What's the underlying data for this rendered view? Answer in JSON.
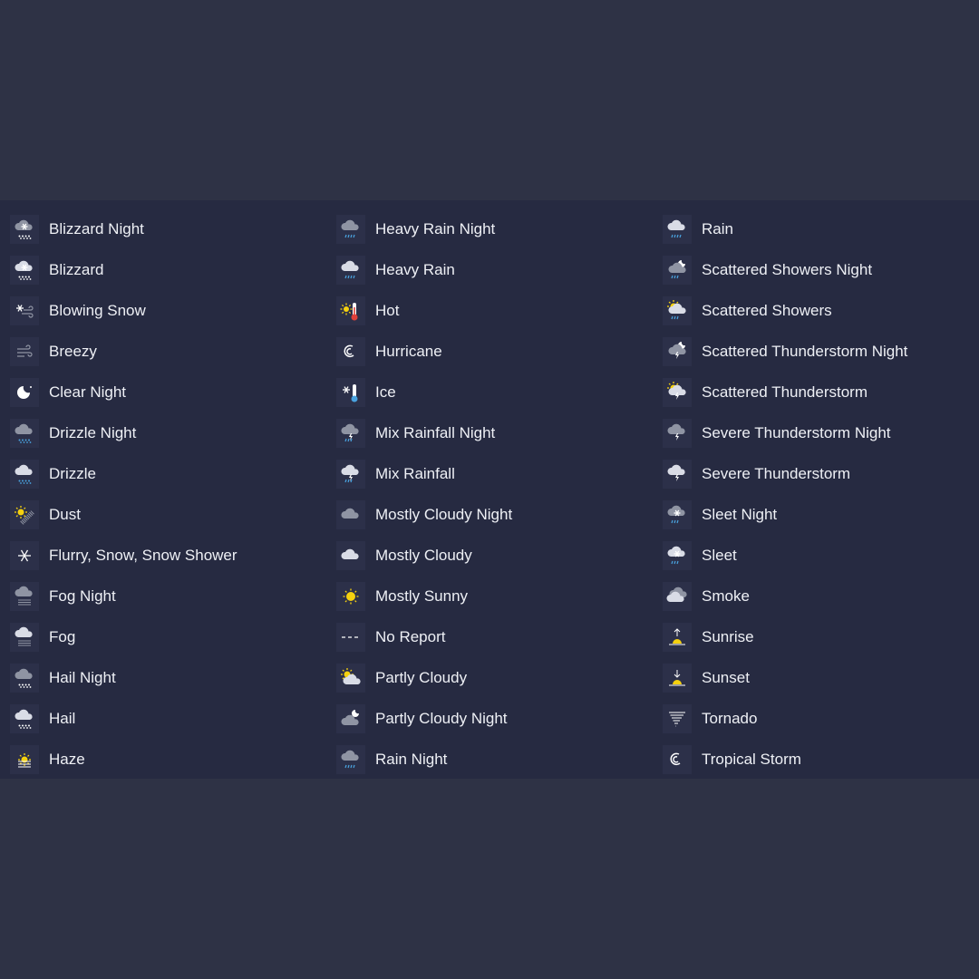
{
  "colors": {
    "background": "#2e3245",
    "panel": "#262a41",
    "tile": "#2c3049",
    "text": "#eef0f5",
    "sun": "#f5d10f",
    "rain": "#4aa3e0",
    "cloud": "#d9dce6",
    "cloud_night": "#8f94a3"
  },
  "columns": [
    [
      {
        "label": "Blizzard Night",
        "icon": "blizzard-night-icon"
      },
      {
        "label": "Blizzard",
        "icon": "blizzard-icon"
      },
      {
        "label": "Blowing Snow",
        "icon": "blowing-snow-icon"
      },
      {
        "label": "Breezy",
        "icon": "breezy-icon"
      },
      {
        "label": "Clear Night",
        "icon": "clear-night-icon"
      },
      {
        "label": "Drizzle Night",
        "icon": "drizzle-night-icon"
      },
      {
        "label": "Drizzle",
        "icon": "drizzle-icon"
      },
      {
        "label": "Dust",
        "icon": "dust-icon"
      },
      {
        "label": "Flurry, Snow, Snow Shower",
        "icon": "snowflake-icon"
      },
      {
        "label": "Fog Night",
        "icon": "fog-night-icon"
      },
      {
        "label": "Fog",
        "icon": "fog-icon"
      },
      {
        "label": "Hail Night",
        "icon": "hail-night-icon"
      },
      {
        "label": "Hail",
        "icon": "hail-icon"
      },
      {
        "label": "Haze",
        "icon": "haze-icon"
      }
    ],
    [
      {
        "label": "Heavy Rain Night",
        "icon": "heavy-rain-night-icon"
      },
      {
        "label": "Heavy Rain",
        "icon": "heavy-rain-icon"
      },
      {
        "label": "Hot",
        "icon": "hot-icon"
      },
      {
        "label": "Hurricane",
        "icon": "hurricane-icon"
      },
      {
        "label": "Ice",
        "icon": "ice-icon"
      },
      {
        "label": "Mix Rainfall Night",
        "icon": "mix-rainfall-night-icon"
      },
      {
        "label": "Mix Rainfall",
        "icon": "mix-rainfall-icon"
      },
      {
        "label": "Mostly Cloudy Night",
        "icon": "mostly-cloudy-night-icon"
      },
      {
        "label": "Mostly Cloudy",
        "icon": "mostly-cloudy-icon"
      },
      {
        "label": "Mostly Sunny",
        "icon": "mostly-sunny-icon"
      },
      {
        "label": "No Report",
        "icon": "no-report-icon"
      },
      {
        "label": "Partly Cloudy",
        "icon": "partly-cloudy-icon"
      },
      {
        "label": "Partly Cloudy Night",
        "icon": "partly-cloudy-night-icon"
      },
      {
        "label": "Rain Night",
        "icon": "rain-night-icon"
      }
    ],
    [
      {
        "label": "Rain",
        "icon": "rain-icon"
      },
      {
        "label": "Scattered Showers Night",
        "icon": "scattered-showers-night-icon"
      },
      {
        "label": "Scattered Showers",
        "icon": "scattered-showers-icon"
      },
      {
        "label": "Scattered Thunderstorm Night",
        "icon": "scattered-thunderstorm-night-icon"
      },
      {
        "label": "Scattered Thunderstorm",
        "icon": "scattered-thunderstorm-icon"
      },
      {
        "label": "Severe Thunderstorm Night",
        "icon": "severe-thunderstorm-night-icon"
      },
      {
        "label": "Severe Thunderstorm",
        "icon": "severe-thunderstorm-icon"
      },
      {
        "label": "Sleet Night",
        "icon": "sleet-night-icon"
      },
      {
        "label": "Sleet",
        "icon": "sleet-icon"
      },
      {
        "label": "Smoke",
        "icon": "smoke-icon"
      },
      {
        "label": "Sunrise",
        "icon": "sunrise-icon"
      },
      {
        "label": "Sunset",
        "icon": "sunset-icon"
      },
      {
        "label": "Tornado",
        "icon": "tornado-icon"
      },
      {
        "label": "Tropical Storm",
        "icon": "tropical-storm-icon"
      }
    ]
  ]
}
